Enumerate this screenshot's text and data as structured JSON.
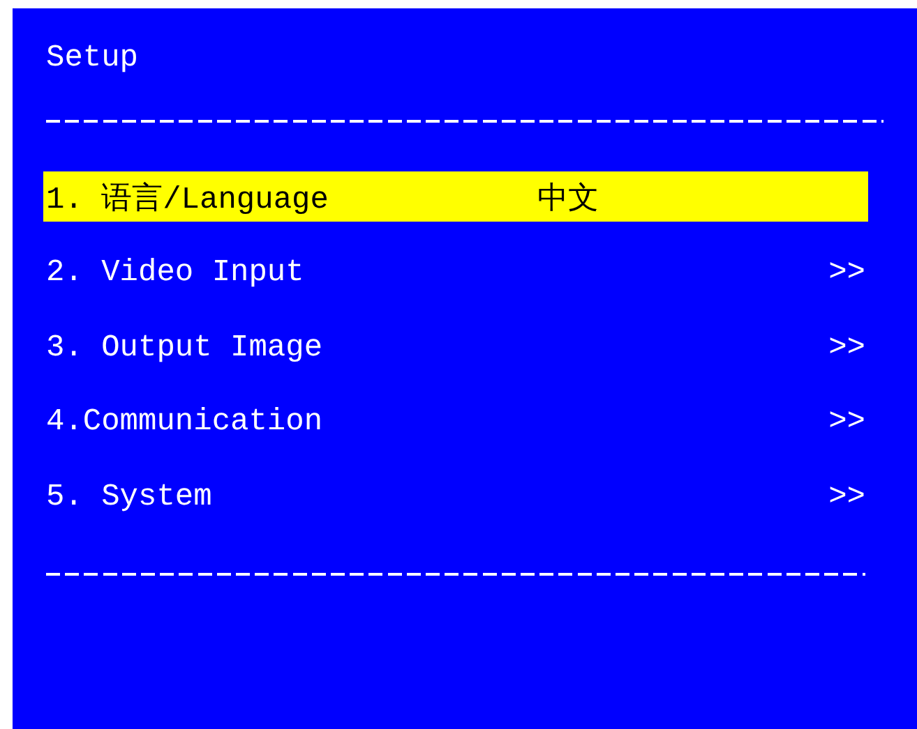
{
  "title": "Setup",
  "items": [
    {
      "label": "1. 语言/Language",
      "value": "中文",
      "selected": true
    },
    {
      "label": "2. Video Input",
      "arrow": ">>",
      "selected": false
    },
    {
      "label": "3. Output Image",
      "arrow": ">>",
      "selected": false
    },
    {
      "label": "4.Communication",
      "arrow": ">>",
      "selected": false
    },
    {
      "label": "5. System",
      "arrow": ">>",
      "selected": false
    }
  ]
}
